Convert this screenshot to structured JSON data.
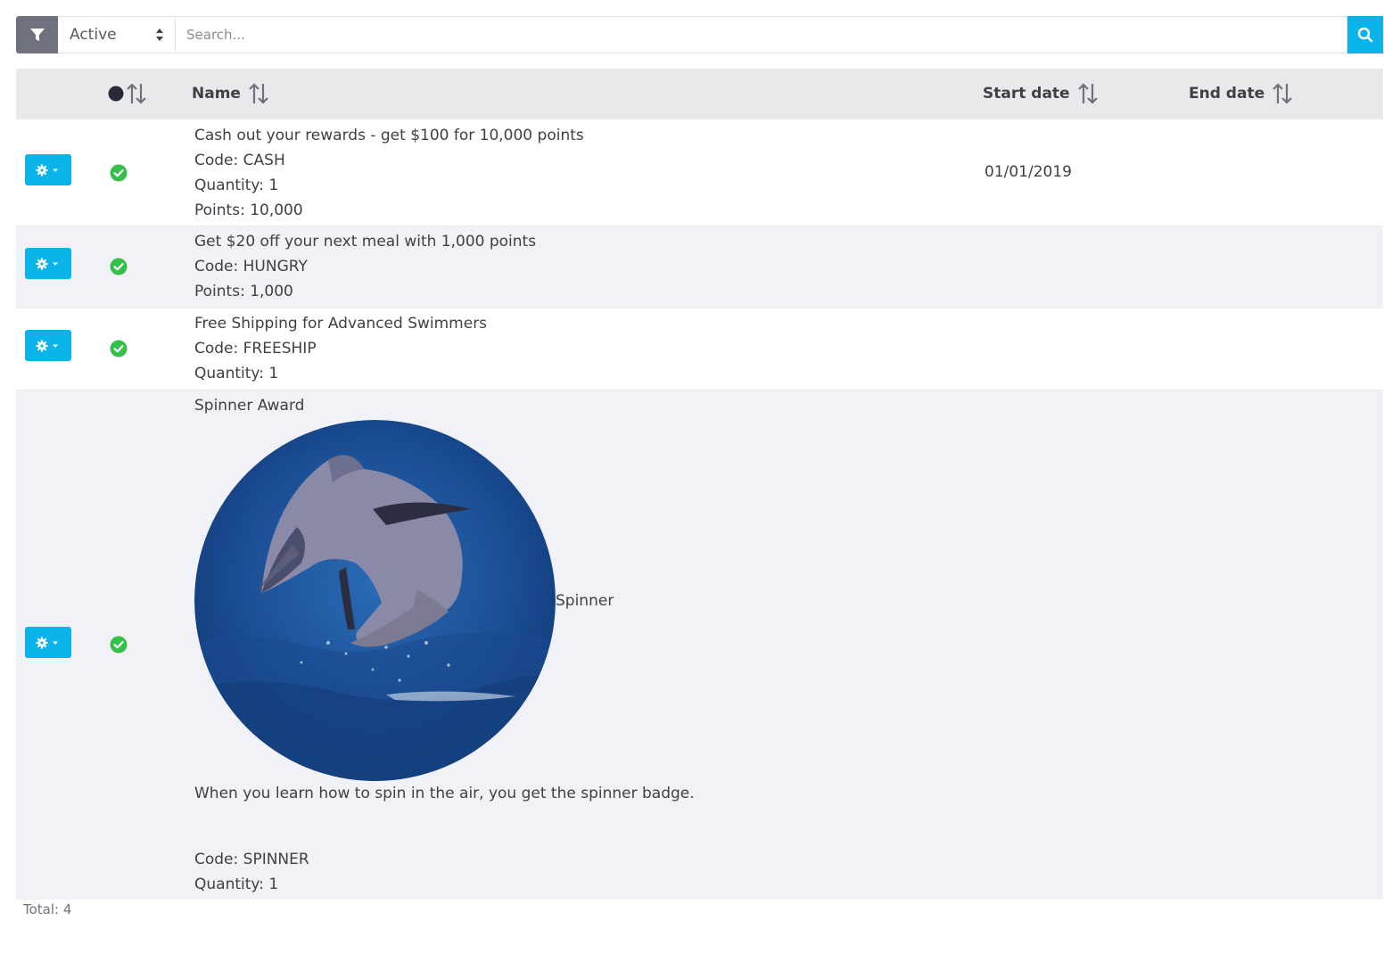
{
  "toolbar": {
    "filter_icon": "filter-icon",
    "status_value": "Active",
    "search_placeholder": "Search...",
    "search_icon": "search-icon"
  },
  "table": {
    "columns": {
      "status_icon": "status-dot-icon",
      "name": "Name",
      "start_date": "Start date",
      "end_date": "End date"
    },
    "rows": [
      {
        "title": "Cash out your rewards - get $100 for 10,000 points",
        "code": "Code: CASH",
        "quantity": "Quantity: 1",
        "points": "Points: 10,000",
        "start_date": "01/01/2019",
        "end_date": ""
      },
      {
        "title": "Get $20 off your next meal with 1,000 points",
        "code": "Code: HUNGRY",
        "points": "Points: 1,000",
        "start_date": "",
        "end_date": ""
      },
      {
        "title": "Free Shipping for Advanced Swimmers",
        "code": "Code: FREESHIP",
        "quantity": "Quantity: 1",
        "start_date": "",
        "end_date": ""
      },
      {
        "title": "Spinner Award",
        "image_caption": "Spinner",
        "description": "When you learn how to spin in the air, you get the spinner badge.",
        "code": "Code: SPINNER",
        "quantity": "Quantity: 1",
        "start_date": "",
        "end_date": ""
      }
    ]
  },
  "footer": {
    "total": "Total: 4"
  },
  "colors": {
    "accent": "#0ab4e8",
    "filter_button": "#6f727d",
    "success": "#34bf49",
    "header_bg": "#e9e9eb",
    "alt_row_bg": "#f1f2f7"
  }
}
